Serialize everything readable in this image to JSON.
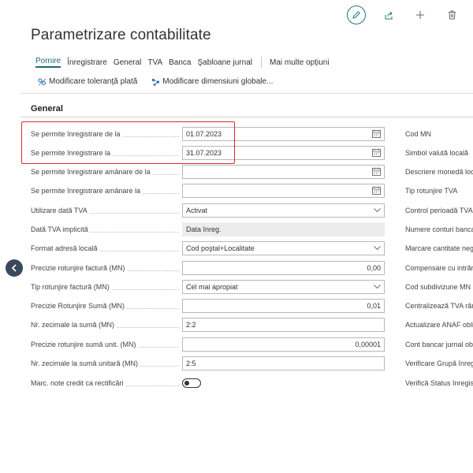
{
  "page": {
    "title": "Parametrizare contabilitate"
  },
  "toolbar": {
    "icons": [
      "edit-icon",
      "share-icon",
      "add-icon",
      "delete-icon"
    ]
  },
  "tabs": [
    {
      "label": "Pornire",
      "active": true
    },
    {
      "label": "Înregistrare"
    },
    {
      "label": "General"
    },
    {
      "label": "TVA"
    },
    {
      "label": "Banca"
    },
    {
      "label": "Şabloane jurnal"
    }
  ],
  "more_options": "Mai multe opțiuni",
  "subactions": [
    {
      "label": "Modificare toleranţă plată",
      "icon": "tolerance-icon"
    },
    {
      "label": "Modificare dimensiuni globale...",
      "icon": "dimensions-icon"
    }
  ],
  "section": {
    "title": "General"
  },
  "fields": [
    {
      "label": "Se permite înregistrare de la",
      "value": "01.07.2023",
      "type": "date"
    },
    {
      "label": "Se permite înregistrare la",
      "value": "31.07.2023",
      "type": "date"
    },
    {
      "label": "Se permite înregistrare amânare de la",
      "value": "",
      "type": "date"
    },
    {
      "label": "Se permite înregistrare amânare la",
      "value": "",
      "type": "date"
    },
    {
      "label": "Utilizare dată TVA",
      "value": "Activat",
      "type": "select"
    },
    {
      "label": "Dată TVA implicită",
      "value": "Data înreg.",
      "type": "readonly"
    },
    {
      "label": "Format adresă locală",
      "value": "Cod poştal+Localitate",
      "type": "select"
    },
    {
      "label": "Precizie rotunjire factură (MN)",
      "value": "0,00",
      "type": "number"
    },
    {
      "label": "Tip rotunjire factură (MN)",
      "value": "Cel mai apropiat",
      "type": "select"
    },
    {
      "label": "Precizie Rotunjire Sumă (MN)",
      "value": "0,01",
      "type": "number"
    },
    {
      "label": "Nr. zecimale la sumă (MN)",
      "value": "2:2",
      "type": "text"
    },
    {
      "label": "Precizie rotunjire sumă unit. (MN)",
      "value": "0,00001",
      "type": "number"
    },
    {
      "label": "Nr. zecimale la sumă unitară (MN)",
      "value": "2:5",
      "type": "text"
    },
    {
      "label": "Marc. note credit ca rectificări",
      "value": "",
      "type": "toggle",
      "on": false
    }
  ],
  "right_labels": [
    "Cod MN",
    "Simbol valută locală",
    "Descriere monedă loc",
    "Tip rotunjire TVA",
    "Control perioadă TVA",
    "Numere conturi banca",
    "Marcare cantitate neg",
    "Compensare cu intrăr",
    "Cod subdivizune MN",
    "Centralizează TVA răm",
    "Actualizare ANAF obli",
    "Cont bancar jurnal ob",
    "Verificare Grupă înreg",
    "Verifică Status înregist"
  ]
}
